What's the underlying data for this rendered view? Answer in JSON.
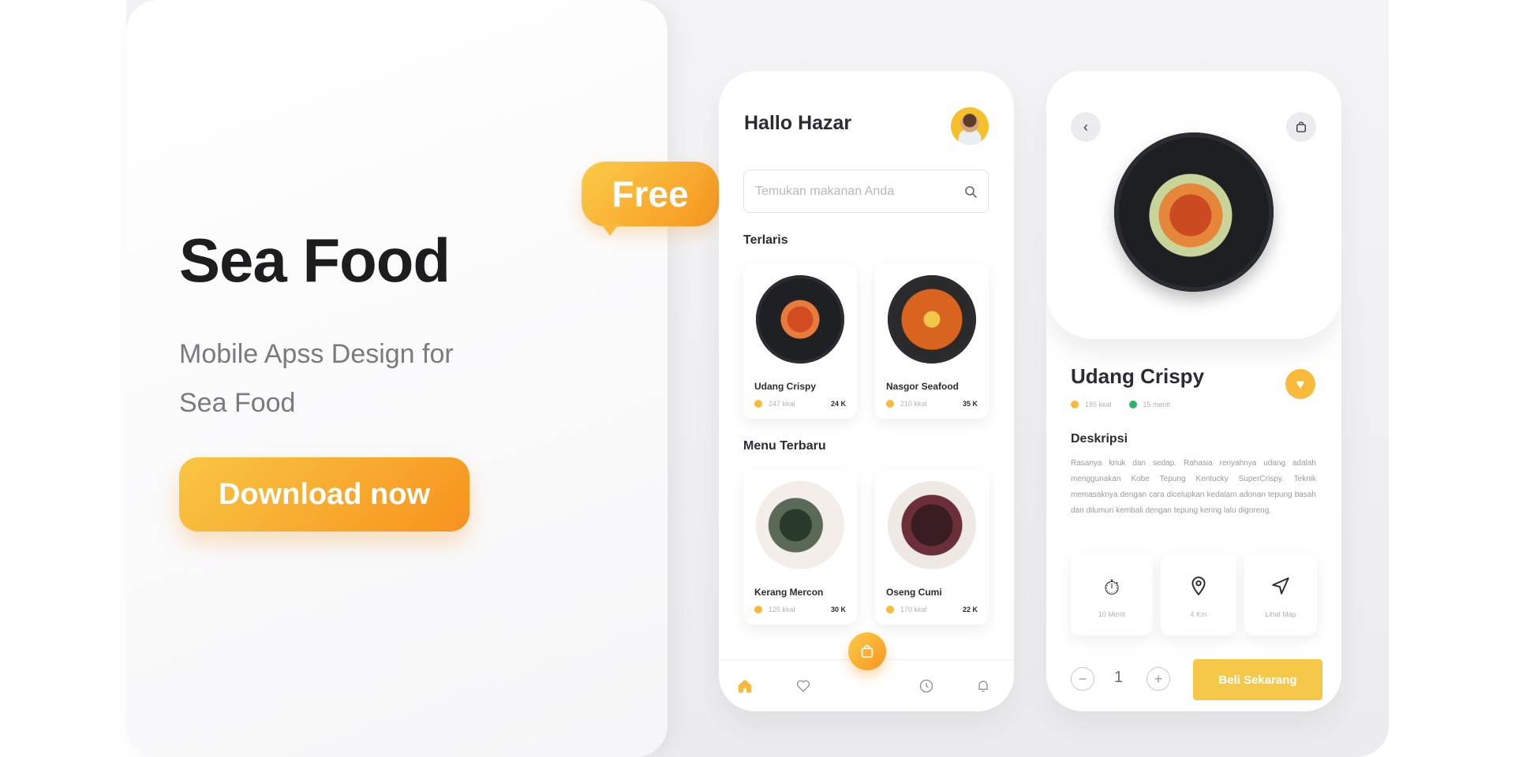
{
  "promo": {
    "title": "Sea Food",
    "subtitle_line1": "Mobile Apss Design for",
    "subtitle_line2": "Sea Food",
    "download_label": "Download now",
    "badge": "Free"
  },
  "home": {
    "greeting": "Hallo Hazar",
    "search_placeholder": "Temukan makanan Anda",
    "bestseller_label": "Terlaris",
    "latest_label": "Menu Terbaru",
    "bestsellers": [
      {
        "name": "Udang Crispy",
        "calories": "247 kkal",
        "price": "24 K"
      },
      {
        "name": "Nasgor Seafood",
        "calories": "210 kkal",
        "price": "35 K"
      }
    ],
    "latest": [
      {
        "name": "Kerang Mercon",
        "calories": "125 kkal",
        "price": "30 K"
      },
      {
        "name": "Oseng Cumi",
        "calories": "170 kkal",
        "price": "22 K"
      }
    ]
  },
  "detail": {
    "name": "Udang Crispy",
    "calories": "185 kkal",
    "duration": "15 menit",
    "desc_title": "Deskripsi",
    "desc_text": "Rasanya kriuk dan sedap. Rahasia renyahnya udang adalah menggunakan Kobe Tepung Kentucky SuperCrispy. Teknik memasaknya dengan cara dicelupkan kedalam adonan tepung basah dan dilumuri kembali dengan tepung kering lalu digoreng.",
    "info": [
      {
        "icon": "timer-icon",
        "label": "10 Menit"
      },
      {
        "icon": "location-pin-icon",
        "label": "4 Km"
      },
      {
        "icon": "navigation-icon",
        "label": "Lihat Map"
      }
    ],
    "quantity": "1",
    "buy_label": "Beli Sekarang"
  },
  "colors": {
    "accent": "#f9b93a",
    "accent_dark": "#f7921e",
    "green": "#2fb36b"
  }
}
